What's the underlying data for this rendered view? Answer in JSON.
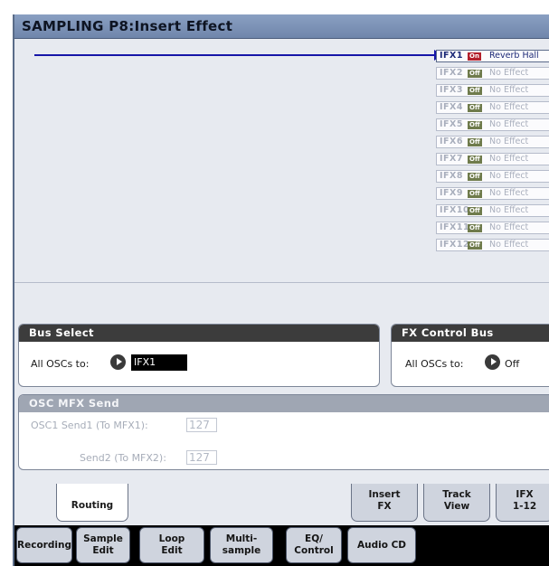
{
  "title": "SAMPLING P8:Insert Effect",
  "ifx_chain": [
    {
      "name": "IFX1",
      "state": "On",
      "effect": "Reverb Hall",
      "active": true
    },
    {
      "name": "IFX2",
      "state": "Off",
      "effect": "No Effect",
      "active": false
    },
    {
      "name": "IFX3",
      "state": "Off",
      "effect": "No Effect",
      "active": false
    },
    {
      "name": "IFX4",
      "state": "Off",
      "effect": "No Effect",
      "active": false
    },
    {
      "name": "IFX5",
      "state": "Off",
      "effect": "No Effect",
      "active": false
    },
    {
      "name": "IFX6",
      "state": "Off",
      "effect": "No Effect",
      "active": false
    },
    {
      "name": "IFX7",
      "state": "Off",
      "effect": "No Effect",
      "active": false
    },
    {
      "name": "IFX8",
      "state": "Off",
      "effect": "No Effect",
      "active": false
    },
    {
      "name": "IFX9",
      "state": "Off",
      "effect": "No Effect",
      "active": false
    },
    {
      "name": "IFX10",
      "state": "Off",
      "effect": "No Effect",
      "active": false
    },
    {
      "name": "IFX11",
      "state": "Off",
      "effect": "No Effect",
      "active": false
    },
    {
      "name": "IFX12",
      "state": "Off",
      "effect": "No Effect",
      "active": false
    }
  ],
  "bus_select": {
    "header": "Bus Select",
    "label": "All OSCs to:",
    "value": "IFX1"
  },
  "fx_control_bus": {
    "header": "FX Control Bus",
    "label": "All OSCs to:",
    "value": "Off"
  },
  "osc_mfx_send": {
    "header": "OSC MFX Send",
    "send1_label": "OSC1 Send1 (To MFX1):",
    "send1_value": "127",
    "send2_label": "Send2 (To MFX2):",
    "send2_value": "127"
  },
  "page_tabs": [
    {
      "line1": "Routing",
      "line2": "",
      "selected": true
    },
    {
      "line1": "Insert",
      "line2": "FX",
      "selected": false
    },
    {
      "line1": "Track",
      "line2": "View",
      "selected": false
    },
    {
      "line1": "IFX",
      "line2": "1-12",
      "selected": false
    }
  ],
  "mode_tabs": [
    {
      "line1": "Recording",
      "line2": ""
    },
    {
      "line1": "Sample",
      "line2": "Edit"
    },
    {
      "line1": "Loop",
      "line2": "Edit"
    },
    {
      "line1": "Multi-",
      "line2": "sample"
    },
    {
      "line1": "EQ/",
      "line2": "Control"
    },
    {
      "line1": "Audio CD",
      "line2": ""
    }
  ],
  "colors": {
    "title_bar": "#7d93b8",
    "active_on": "#b3202c",
    "off_badge": "#6f7b4c",
    "route_line": "#1616a8"
  }
}
